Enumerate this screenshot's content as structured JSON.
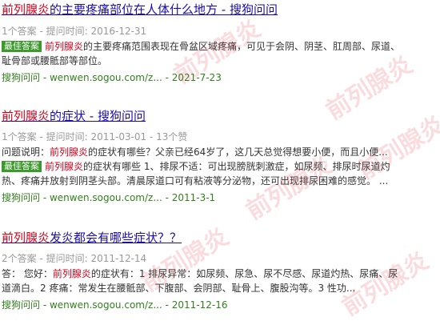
{
  "results": [
    {
      "title_hl": "前列腺炎",
      "title_rest": "的主要疼痛部位在人体什么地方 - 搜狗问问",
      "meta": "1个答案 - 提问时间: 2016-12-31",
      "badge": "最佳答案",
      "line1_pre": "",
      "line1_hl": "前列腺炎",
      "line1_rest": "的主要疼痛范围表现在骨盆区域疼痛，可见于会阴、阴茎、肛周部、尿道、",
      "line2": "耻骨部或腰骶部等部位。",
      "source": "搜狗问问 - wenwen.sogou.com/z... - 2021-7-23"
    },
    {
      "title_hl": "前列腺炎",
      "title_rest": "的症状 - 搜狗问问",
      "meta": "1个答案 - 提问时间: 2011-03-01 - 13个赞",
      "question_label": "问题说明：",
      "question_hl": "前列腺炎",
      "question_rest": "的症状有哪些？父亲已经64岁了，这几天总觉得想要小便，而且小便...",
      "badge": "最佳答案",
      "line1_hl": "前列腺炎",
      "line1_rest": "的症状有哪些 1、排尿不适：可出现膀胱刺激症，如尿频、排尿时尿道灼",
      "line2": "热、疼痛并放射到阴茎头部。清晨尿道口可有粘液等分泌物，还可出现排尿困难的感觉。 ...",
      "source": "搜狗问问 - wenwen.sogou.com/z... - 2011-3-1"
    },
    {
      "title_hl": "前列腺炎",
      "title_rest": "发炎都会有哪些症状？？",
      "meta": "2个答案 - 提问时间: 2011-12-14",
      "answer_label": "答： 您好：",
      "line1_hl": "前列腺炎",
      "line1_rest": "的症状有：1 排尿异常：如尿频、尿急、尿不尽感、尿道灼热、尿痛、尿",
      "line2": "道滴白。2 疼痛：常发生在腰骶部、下腹部、会阴部、耻骨上、腹股沟等。3 性功...",
      "source": "搜狗问问 - wenwen.sogou.com/z... - 2011-12-16"
    }
  ],
  "watermark": "前列腺炎"
}
